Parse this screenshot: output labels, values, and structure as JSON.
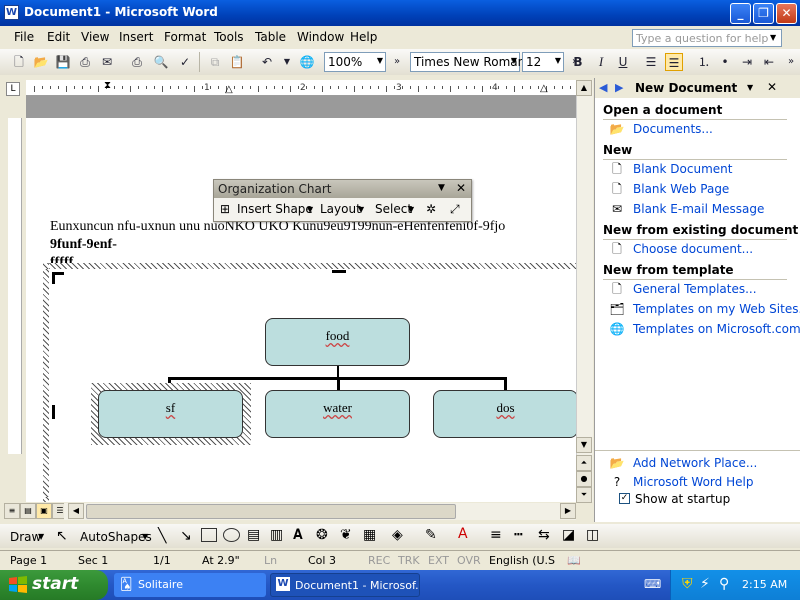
{
  "window": {
    "title": "Document1 - Microsoft Word",
    "app_icon": "W"
  },
  "menubar": {
    "items": [
      "File",
      "Edit",
      "View",
      "Insert",
      "Format",
      "Tools",
      "Table",
      "Window",
      "Help"
    ],
    "help_placeholder": "Type a question for help"
  },
  "toolbar": {
    "zoom": "100%",
    "font": "Times New Roman",
    "size": "12",
    "bold": "B",
    "italic": "I",
    "underline": "U"
  },
  "ruler": {
    "numbers": [
      "1",
      "2",
      "3",
      "4"
    ]
  },
  "document": {
    "line1": "Eunxuncun nfu-uxnun unu nuoNKO UKO Kunu9eu9199nun-eHenfenfeni0f-9fjo",
    "line2": "9funf-9enf-",
    "line3": "fffff"
  },
  "org_toolbar": {
    "title": "Organization Chart",
    "insert_shape": "Insert Shape",
    "layout": "Layout",
    "select": "Select"
  },
  "org_chart": {
    "root": "food",
    "children": [
      "sf",
      "water",
      "dos"
    ],
    "fill": "#BCDEDE"
  },
  "task_pane": {
    "title": "New Document",
    "open_section": "Open a document",
    "documents_link": "Documents...",
    "new_section": "New",
    "new_links": [
      "Blank Document",
      "Blank Web Page",
      "Blank E-mail Message"
    ],
    "existing_section": "New from existing document",
    "choose_link": "Choose document...",
    "template_section": "New from template",
    "template_links": [
      "General Templates...",
      "Templates on my Web Sites...",
      "Templates on Microsoft.com"
    ],
    "footer_links": [
      "Add Network Place...",
      "Microsoft Word Help"
    ],
    "show_startup": "Show at startup"
  },
  "drawbar": {
    "draw": "Draw",
    "autoshapes": "AutoShapes"
  },
  "status": {
    "page": "Page  1",
    "sec": "Sec  1",
    "pages": "1/1",
    "at": "At  2.9\"",
    "ln": "Ln",
    "col": "Col  3",
    "rec": "REC",
    "trk": "TRK",
    "ext": "EXT",
    "ovr": "OVR",
    "lang": "English (U.S"
  },
  "taskbar": {
    "start": "start",
    "tasks": [
      "Solitaire",
      "Document1 - Microsof..."
    ],
    "clock": "2:15 AM"
  }
}
